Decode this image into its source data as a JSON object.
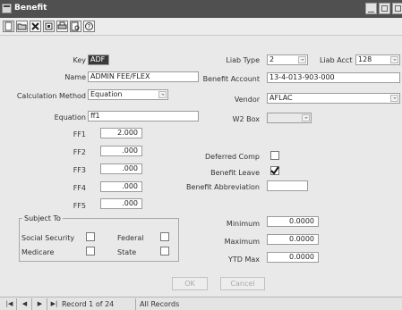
{
  "window": {
    "title": "Benefit"
  },
  "form": {
    "key": {
      "label": "Key",
      "value": "ADF"
    },
    "name": {
      "label": "Name",
      "value": "ADMIN FEE/FLEX"
    },
    "calculation_method": {
      "label": "Calculation Method",
      "value": "Equation"
    },
    "equation": {
      "label": "Equation",
      "value": "ff1"
    },
    "ff_fields": [
      {
        "label": "FF1",
        "value": "2.000"
      },
      {
        "label": "FF2",
        "value": ".000"
      },
      {
        "label": "FF3",
        "value": ".000"
      },
      {
        "label": "FF4",
        "value": ".000"
      },
      {
        "label": "FF5",
        "value": ".000"
      }
    ],
    "subject_to": {
      "title": "Subject To",
      "social_security": {
        "label": "Social Security",
        "checked": false
      },
      "federal": {
        "label": "Federal",
        "checked": false
      },
      "medicare": {
        "label": "Medicare",
        "checked": false
      },
      "state": {
        "label": "State",
        "checked": false
      }
    },
    "liab_type": {
      "label": "Liab Type",
      "value": "2"
    },
    "liab_acct": {
      "label": "Liab Acct",
      "value": "128"
    },
    "benefit_account": {
      "label": "Benefit Account",
      "value": "13-4-013-903-000"
    },
    "vendor": {
      "label": "Vendor",
      "value": "AFLAC"
    },
    "w2_box": {
      "label": "W2 Box",
      "value": ""
    },
    "deferred_comp": {
      "label": "Deferred Comp",
      "checked": false
    },
    "benefit_leave": {
      "label": "Benefit Leave",
      "checked": true
    },
    "benefit_abbreviation": {
      "label": "Benefit Abbreviation",
      "value": ""
    },
    "minimum": {
      "label": "Minimum",
      "value": "0.0000"
    },
    "maximum": {
      "label": "Maximum",
      "value": "0.0000"
    },
    "ytd_max": {
      "label": "YTD Max",
      "value": "0.0000"
    }
  },
  "buttons": {
    "ok": "OK",
    "cancel": "Cancel"
  },
  "status": {
    "record": "Record 1 of 24",
    "filter": "All Records"
  }
}
